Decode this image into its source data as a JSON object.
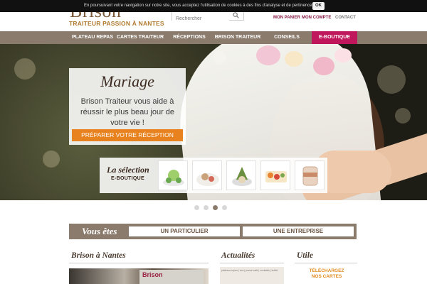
{
  "cookie_bar": {
    "text": "En poursuivant votre navigation sur notre site, vous acceptez l'utilisation de cookies à des fins d'analyse et de pertinence.",
    "ok_label": "OK"
  },
  "header": {
    "logo_text": "Brison",
    "tagline": "TRAITEUR PASSION À NANTES",
    "search_placeholder": "Rechercher",
    "links": [
      "MON PANIER",
      "MON COMPTE",
      "CONTACT"
    ]
  },
  "nav": {
    "items": [
      "PLATEAU REPAS",
      "CARTES TRAITEUR",
      "RÉCEPTIONS",
      "BRISON TRAITEUR",
      "CONSEILS",
      "E-BOUTIQUE"
    ]
  },
  "hero": {
    "title": "Mariage",
    "text": "Brison Traiteur vous aide à réussir le plus beau jour de votre vie !",
    "button": "PRÉPARER VOTRE RÉCEPTION",
    "selection_title": "La sélection",
    "selection_subtitle": "E-BOUTIQUE",
    "slide_count": 4,
    "active_slide": 3
  },
  "vous_etes": {
    "label": "Vous êtes",
    "options": [
      "UN PARTICULIER",
      "UNE ENTREPRISE"
    ]
  },
  "columns": {
    "nantes_title": "Brison à Nantes",
    "nantes_image_text": "Brison",
    "actualites_title": "Actualités",
    "actualites_image_text": "plateaux repas | box | pause café | cocktails | buffet",
    "utile_title": "Utile",
    "utile_link": "TÉLÉCHARGEZ NOS CARTES"
  },
  "colors": {
    "brown": "#8b7b6c",
    "accent_pink": "#c0175c",
    "orange": "#e8821e",
    "dark_link": "#8a1c46"
  }
}
